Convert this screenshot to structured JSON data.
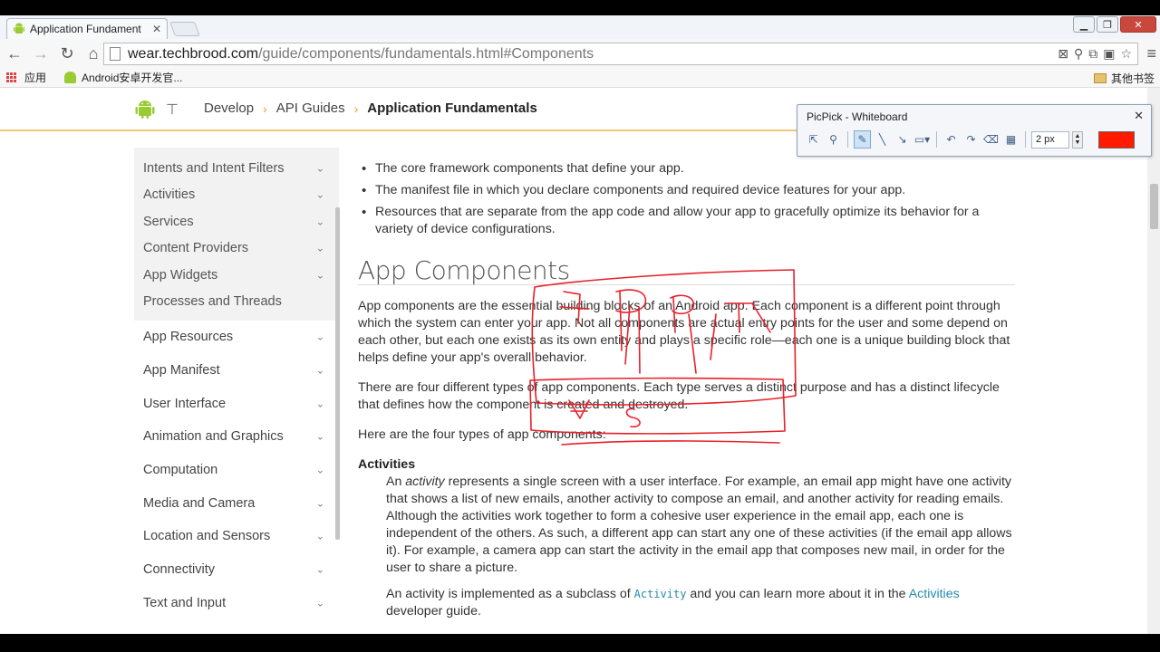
{
  "browser": {
    "tab_title": "Application Fundament",
    "url_host": "wear.techbrood.com",
    "url_path": "/guide/components/fundamentals.html#Components",
    "bookmarks": [
      {
        "label": "应用",
        "icon": "apps-grid-icon"
      },
      {
        "label": "Android安卓开发官...",
        "icon": "android-icon"
      }
    ],
    "other_bookmarks": "其他书签"
  },
  "site": {
    "breadcrumbs": [
      "Develop",
      "API Guides",
      "Application Fundamentals"
    ]
  },
  "sidebar": {
    "group_items": [
      {
        "label": "Intents and Intent Filters",
        "has_chevron": true
      },
      {
        "label": "Activities",
        "has_chevron": true
      },
      {
        "label": "Services",
        "has_chevron": true
      },
      {
        "label": "Content Providers",
        "has_chevron": true
      },
      {
        "label": "App Widgets",
        "has_chevron": true
      },
      {
        "label": "Processes and Threads",
        "has_chevron": false
      }
    ],
    "items": [
      {
        "label": "App Resources"
      },
      {
        "label": "App Manifest"
      },
      {
        "label": "User Interface"
      },
      {
        "label": "Animation and Graphics"
      },
      {
        "label": "Computation"
      },
      {
        "label": "Media and Camera"
      },
      {
        "label": "Location and Sensors"
      },
      {
        "label": "Connectivity"
      },
      {
        "label": "Text and Input"
      }
    ]
  },
  "content": {
    "bullets": [
      "The core framework components that define your app.",
      "The manifest file in which you declare components and required device features for your app.",
      "Resources that are separate from the app code and allow your app to gracefully optimize its behavior for a variety of device configurations."
    ],
    "heading": "App Components",
    "para1": "App components are the essential building blocks of an Android app. Each component is a different point through which the system can enter your app. Not all components are actual entry points for the user and some depend on each other, but each one exists as its own entity and plays a specific role—each one is a unique building block that helps define your app's overall behavior.",
    "para2": "There are four different types of app components. Each type serves a distinct purpose and has a distinct lifecycle that defines how the component is created and destroyed.",
    "para3": "Here are the four types of app components:",
    "subheading": "Activities",
    "activity_p1_pre": "An ",
    "activity_p1_em": "activity",
    "activity_p1_post": " represents a single screen with a user interface. For example, an email app might have one activity that shows a list of new emails, another activity to compose an email, and another activity for reading emails. Although the activities work together to form a cohesive user experience in the email app, each one is independent of the others. As such, a different app can start any one of these activities (if the email app allows it). For example, a camera app can start the activity in the email app that composes new mail, in order for the user to share a picture.",
    "activity_p2_pre": "An activity is implemented as a subclass of ",
    "activity_p2_code": "Activity",
    "activity_p2_mid": " and you can learn more about it in the ",
    "activity_p2_link": "Activities",
    "activity_p2_post": " developer guide."
  },
  "picpick": {
    "title": "PicPick - Whiteboard",
    "line_width": "2 px",
    "color": "#ff1a00",
    "tools": [
      "pointer-icon",
      "zoom-icon",
      "pen-icon",
      "line-icon",
      "arrow-line-icon",
      "rectangle-icon",
      "undo-icon",
      "redo-icon",
      "eraser-icon",
      "clear-icon"
    ]
  },
  "annotation_color": "#e8202a"
}
